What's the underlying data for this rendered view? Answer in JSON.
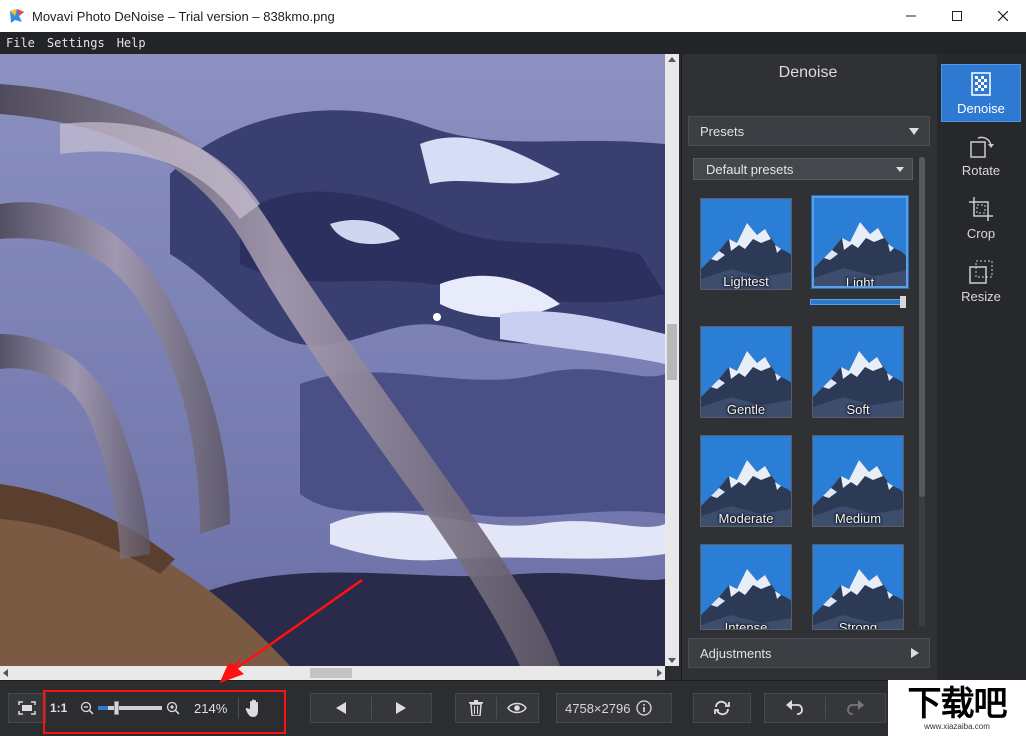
{
  "window": {
    "title": "Movavi Photo DeNoise – Trial version – 838kmo.png",
    "controls": [
      "minimize",
      "maximize",
      "close"
    ]
  },
  "menu": {
    "items": [
      "File",
      "Settings",
      "Help"
    ]
  },
  "panel": {
    "title": "Denoise",
    "presets_header": "Presets",
    "dropdown_value": "Default presets",
    "presets": [
      "Lightest",
      "Light",
      "Gentle",
      "Soft",
      "Moderate",
      "Medium",
      "Intense",
      "Strong"
    ],
    "selected_preset": "Light",
    "preset_strength": 1.0,
    "adjustments_header": "Adjustments"
  },
  "tools": {
    "items": [
      "Denoise",
      "Rotate",
      "Crop",
      "Resize"
    ],
    "active": "Denoise"
  },
  "bottombar": {
    "actual_size": "1:1",
    "zoom_percent": "214%",
    "zoom_level": 0.15,
    "dimensions": "4758×2796"
  },
  "watermark": {
    "text": "下载吧",
    "url": "www.xiazaiba.com"
  },
  "colors": {
    "accent": "#2e7ad2",
    "annotation": "#ff1111"
  }
}
